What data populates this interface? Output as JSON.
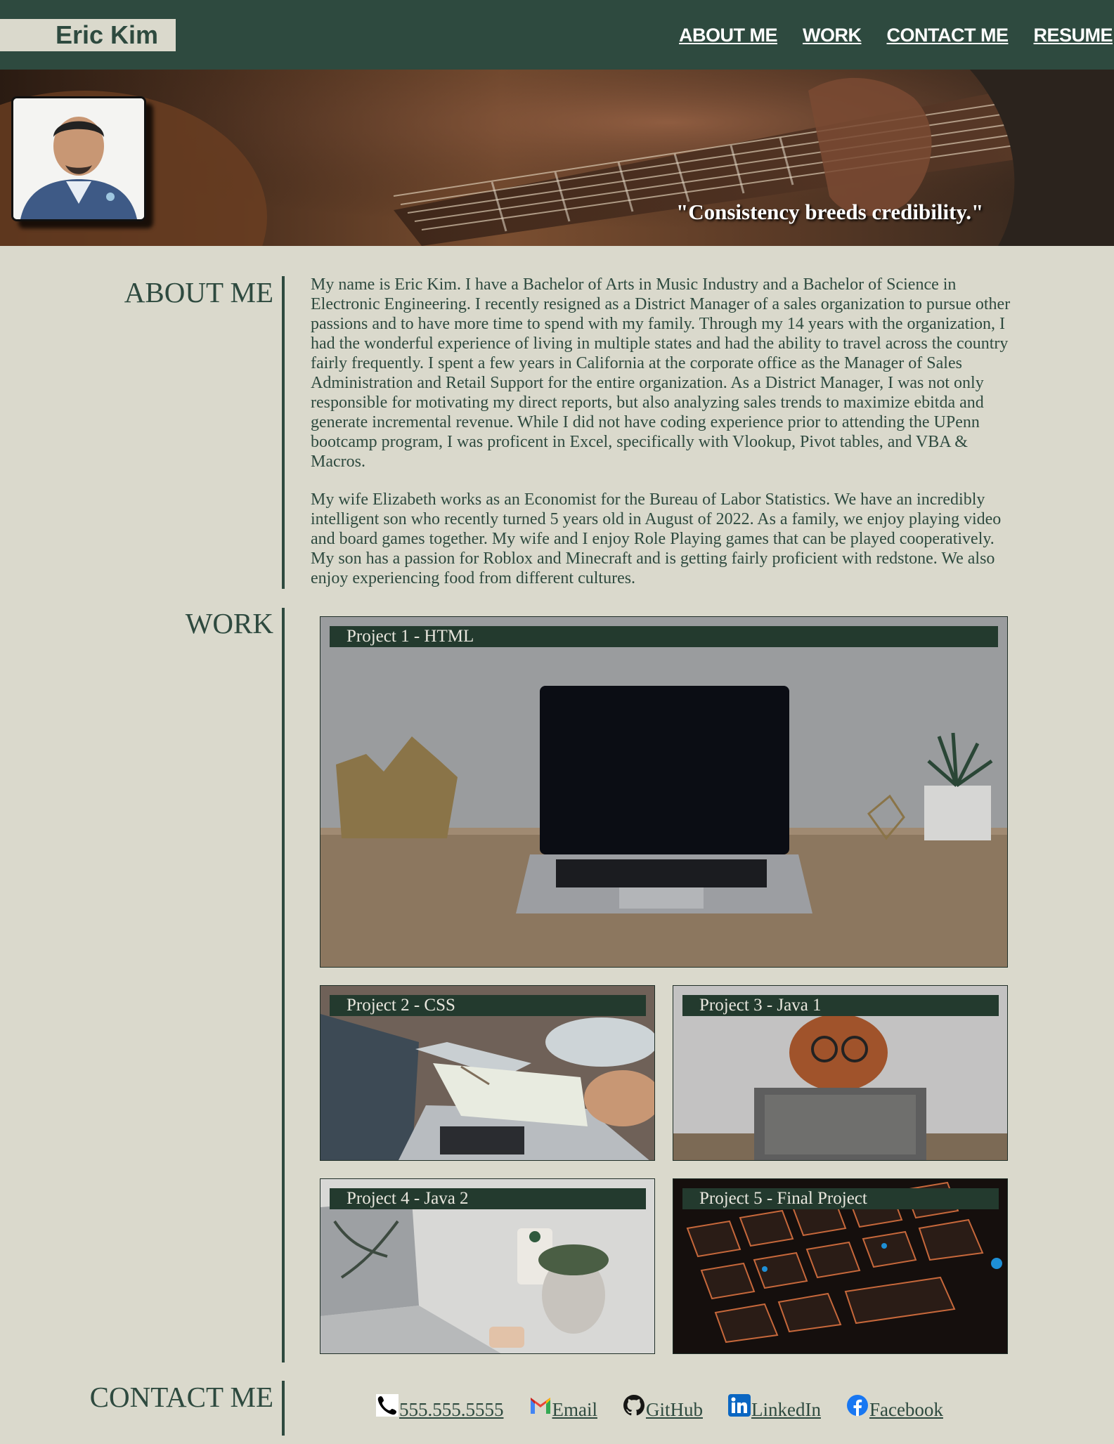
{
  "header": {
    "brand": "Eric Kim",
    "nav": [
      "ABOUT ME",
      "WORK",
      "CONTACT ME",
      "RESUME"
    ]
  },
  "hero": {
    "quote": "\"Consistency breeds credibility.\"",
    "avatar_icon": "profile-photo"
  },
  "about": {
    "title": "ABOUT ME",
    "paragraphs": [
      "My name is Eric Kim. I have a Bachelor of Arts in Music Industry and a Bachelor of Science in Electronic Engineering. I recently resigned as a District Manager of a sales organization to pursue other passions and to have more time to spend with my family. Through my 14 years with the organization, I had the wonderful experience of living in multiple states and had the ability to travel across the country fairly frequently. I spent a few years in California at the corporate office as the Manager of Sales Administration and Retail Support for the entire organization. As a District Manager, I was not only responsible for motivating my direct reports, but also analyzing sales trends to maximize ebitda and generate incremental revenue. While I did not have coding experience prior to attending the UPenn bootcamp program, I was proficent in Excel, specifically with Vlookup, Pivot tables, and VBA & Macros.",
      "My wife Elizabeth works as an Economist for the Bureau of Labor Statistics. We have an incredibly intelligent son who recently turned 5 years old in August of 2022. As a family, we enjoy playing video and board games together. My wife and I enjoy Role Playing games that can be played cooperatively. My son has a passion for Roblox and Minecraft and is getting fairly proficient with redstone. We also enjoy experiencing food from different cultures."
    ]
  },
  "work": {
    "title": "WORK",
    "projects": [
      {
        "label": "Project 1 - HTML",
        "image": "laptop-on-desk"
      },
      {
        "label": "Project 2 - CSS",
        "image": "people-writing-at-laptops"
      },
      {
        "label": "Project 3 - Java 1",
        "image": "dog-with-glasses-and-tablet"
      },
      {
        "label": "Project 4 - Java 2",
        "image": "laptop-with-plant-and-coffee"
      },
      {
        "label": "Project 5 - Final Project",
        "image": "backlit-keyboard"
      }
    ]
  },
  "contact": {
    "title": "CONTACT ME",
    "links": [
      {
        "label": "555.555.5555",
        "icon": "phone-icon"
      },
      {
        "label": "Email",
        "icon": "gmail-icon"
      },
      {
        "label": "GitHub",
        "icon": "github-icon"
      },
      {
        "label": "LinkedIn",
        "icon": "linkedin-icon"
      },
      {
        "label": "Facebook",
        "icon": "facebook-icon"
      }
    ]
  },
  "colors": {
    "primary": "#2e4a3f",
    "background": "#dad9cc",
    "label_band": "#233a2e"
  }
}
